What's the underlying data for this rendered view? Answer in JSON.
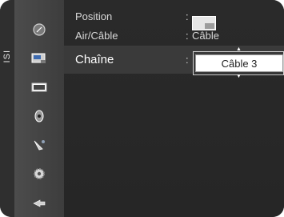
{
  "source_tag": "ISI",
  "menu": {
    "rows": [
      {
        "label": "Position",
        "colon": ":",
        "value": ""
      },
      {
        "label": "Air/Câble",
        "colon": ":",
        "value": "Câble"
      },
      {
        "label": "Chaîne",
        "colon": ":",
        "value": "Câble 3"
      }
    ]
  },
  "sidebar_icons": [
    "picture-icon",
    "pip-icon",
    "screen-icon",
    "sound-icon",
    "satellite-icon",
    "setup-icon",
    "input-icon"
  ],
  "colors": {
    "background": "#2a2a2a",
    "sidebar": "#4c4c4c",
    "text": "#d8d8d8",
    "value_box": "#ffffff"
  }
}
